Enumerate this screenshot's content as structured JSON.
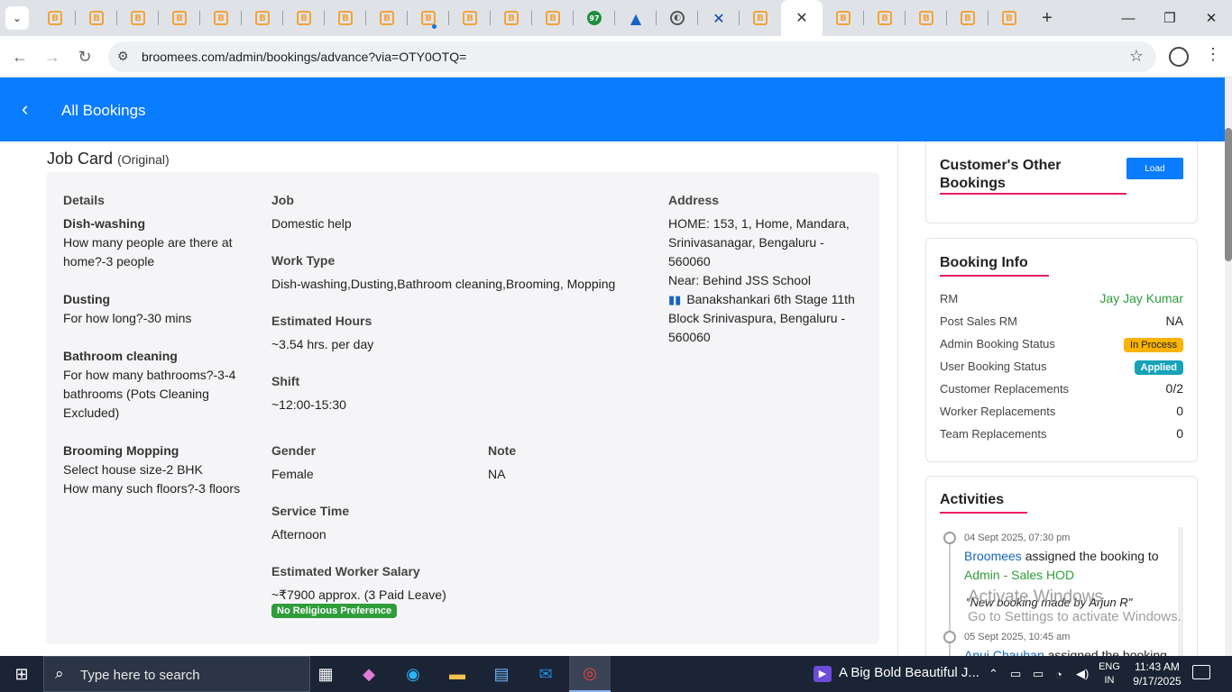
{
  "browser": {
    "url": "broomees.com/admin/bookings/advance?via=OTY0OTQ=",
    "tab_favicon_letter": "B",
    "tab_badge": "97"
  },
  "header": {
    "title": "All Bookings"
  },
  "job_card": {
    "title": "Job Card",
    "subtitle": "(Original)",
    "details": {
      "label": "Details",
      "items": [
        {
          "title": "Dish-washing",
          "text": "How many people are there at home?-3 people"
        },
        {
          "title": "Dusting",
          "text": "For how long?-30 mins"
        },
        {
          "title": "Bathroom cleaning",
          "text": "For how many bathrooms?-3-4 bathrooms (Pots Cleaning Excluded)"
        },
        {
          "title": "Brooming Mopping",
          "text": "Select house size-2 BHK",
          "text2": "How many such floors?-3 floors"
        }
      ]
    },
    "job": {
      "label": "Job",
      "value": "Domestic help"
    },
    "work_type": {
      "label": "Work Type",
      "value": "Dish-washing,Dusting,Bathroom cleaning,Brooming, Mopping"
    },
    "estimated_hours": {
      "label": "Estimated Hours",
      "value": "~3.54 hrs. per day"
    },
    "shift": {
      "label": "Shift",
      "value": "~12:00-15:30"
    },
    "gender": {
      "label": "Gender",
      "value": "Female"
    },
    "note": {
      "label": "Note",
      "value": "NA"
    },
    "service_time": {
      "label": "Service Time",
      "value": "Afternoon"
    },
    "salary": {
      "label": "Estimated Worker Salary",
      "value": "~₹7900 approx. (3 Paid Leave)"
    },
    "religion_badge": "No Religious Preference",
    "address": {
      "label": "Address",
      "home": "HOME: 153, 1, Home, Mandara, Srinivasanagar, Bengaluru - 560060",
      "near": "Near: Behind JSS School",
      "map_text": "Banakshankari 6th Stage 11th Block Srinivaspura, Bengaluru - 560060"
    }
  },
  "other_bookings": {
    "title": "Customer's Other Bookings",
    "load_label": "Load"
  },
  "booking_info": {
    "title": "Booking Info",
    "rows": [
      {
        "key": "RM",
        "value": "Jay Jay Kumar"
      },
      {
        "key": "Post Sales RM",
        "value": "NA"
      },
      {
        "key": "Admin Booking Status",
        "value": "In Process"
      },
      {
        "key": "User Booking Status",
        "value": "Applied"
      },
      {
        "key": "Customer Replacements",
        "value": "0/2"
      },
      {
        "key": "Worker Replacements",
        "value": "0"
      },
      {
        "key": "Team Replacements",
        "value": "0"
      }
    ]
  },
  "activities": {
    "title": "Activities",
    "items": [
      {
        "time": "04 Sept 2025, 07:30 pm",
        "actor": "Broomees",
        "action": "assigned the booking to",
        "target": "Admin - Sales HOD",
        "quote": "\"New booking made by Arjun R\""
      },
      {
        "time": "05 Sept 2025, 10:45 am",
        "actor": "Anuj Chauhan",
        "action": "assigned the booking"
      }
    ]
  },
  "watermark": {
    "line1": "Activate Windows",
    "line2": "Go to Settings to activate Windows."
  },
  "taskbar": {
    "search_placeholder": "Type here to search",
    "media_title": "A Big Bold Beautiful J...",
    "lang_top": "ENG",
    "lang_bottom": "IN",
    "time": "11:43 AM",
    "date": "9/17/2025"
  },
  "colors": {
    "header_blue": "#0a7cff",
    "accent_pink": "#e91e63",
    "status_green": "#2e9d3a",
    "status_orange": "#f9b300",
    "status_teal": "#17a2b8"
  }
}
